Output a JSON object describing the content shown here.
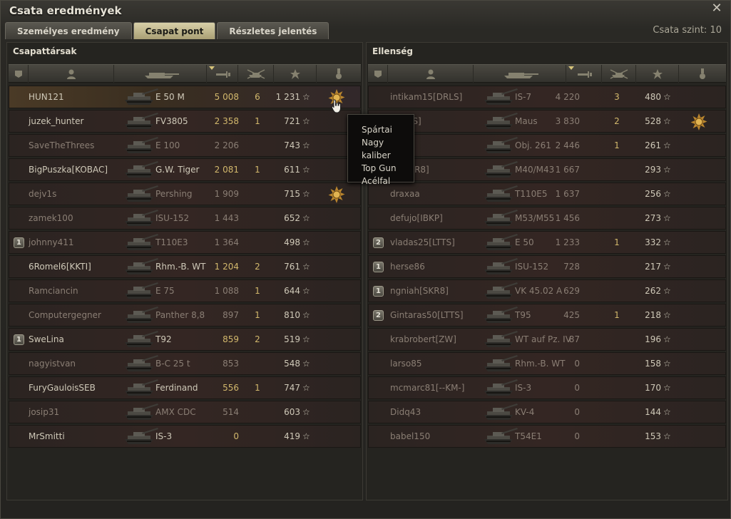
{
  "window": {
    "title": "Csata eredmények"
  },
  "tabs": [
    {
      "label": "Személyes eredmény",
      "active": false
    },
    {
      "label": "Csapat pont",
      "active": true
    },
    {
      "label": "Részletes jelentés",
      "active": false
    }
  ],
  "battle_level": "Csata szint: 10",
  "allies": {
    "title": "Csapattársak",
    "rows": [
      {
        "squad": "",
        "name": "HUN121",
        "tank": "E 50 M",
        "damage": "5 008",
        "kills": "6",
        "xp": "1 231",
        "medal": true,
        "alive": true,
        "self": true,
        "hi": true
      },
      {
        "squad": "",
        "name": "juzek_hunter",
        "tank": "FV3805",
        "damage": "2 358",
        "kills": "1",
        "xp": "721",
        "medal": false,
        "alive": true,
        "self": false,
        "hi": true
      },
      {
        "squad": "",
        "name": "SaveTheThrees",
        "tank": "E 100",
        "damage": "2 206",
        "kills": "",
        "xp": "743",
        "medal": false,
        "alive": false,
        "self": false,
        "hi": false
      },
      {
        "squad": "",
        "name": "BigPuszka[KOBAC]",
        "tank": "G.W. Tiger",
        "damage": "2 081",
        "kills": "1",
        "xp": "611",
        "medal": false,
        "alive": true,
        "self": false,
        "hi": true
      },
      {
        "squad": "",
        "name": "dejv1s",
        "tank": "Pershing",
        "damage": "1 909",
        "kills": "",
        "xp": "715",
        "medal": true,
        "alive": false,
        "self": false,
        "hi": false
      },
      {
        "squad": "",
        "name": "zamek100",
        "tank": "ISU-152",
        "damage": "1 443",
        "kills": "",
        "xp": "652",
        "medal": false,
        "alive": false,
        "self": false,
        "hi": false
      },
      {
        "squad": "1",
        "name": "johnny411",
        "tank": "T110E3",
        "damage": "1 364",
        "kills": "",
        "xp": "498",
        "medal": false,
        "alive": false,
        "self": false,
        "hi": false
      },
      {
        "squad": "",
        "name": "6Romel6[KKTI]",
        "tank": "Rhm.-B. WT",
        "damage": "1 204",
        "kills": "2",
        "xp": "761",
        "medal": false,
        "alive": true,
        "self": false,
        "hi": true
      },
      {
        "squad": "",
        "name": "Ramciancin",
        "tank": "E 75",
        "damage": "1 088",
        "kills": "1",
        "xp": "644",
        "medal": false,
        "alive": false,
        "self": false,
        "hi": false
      },
      {
        "squad": "",
        "name": "Computergegner",
        "tank": "Panther 8,8",
        "damage": "897",
        "kills": "1",
        "xp": "810",
        "medal": false,
        "alive": false,
        "self": false,
        "hi": false
      },
      {
        "squad": "1",
        "name": "SweLina",
        "tank": "T92",
        "damage": "859",
        "kills": "2",
        "xp": "519",
        "medal": false,
        "alive": true,
        "self": false,
        "hi": true
      },
      {
        "squad": "",
        "name": "nagyistvan",
        "tank": "B-C 25 t",
        "damage": "853",
        "kills": "",
        "xp": "548",
        "medal": false,
        "alive": false,
        "self": false,
        "hi": false
      },
      {
        "squad": "",
        "name": "FuryGauloisSEB",
        "tank": "Ferdinand",
        "damage": "556",
        "kills": "1",
        "xp": "747",
        "medal": false,
        "alive": true,
        "self": false,
        "hi": true
      },
      {
        "squad": "",
        "name": "josip31",
        "tank": "AMX CDC",
        "damage": "514",
        "kills": "",
        "xp": "603",
        "medal": false,
        "alive": false,
        "self": false,
        "hi": false
      },
      {
        "squad": "",
        "name": "MrSmitti",
        "tank": "IS-3",
        "damage": "0",
        "kills": "",
        "xp": "419",
        "medal": false,
        "alive": true,
        "self": false,
        "hi": true
      }
    ]
  },
  "enemies": {
    "title": "Ellenség",
    "rows": [
      {
        "squad": "",
        "name": "intikam15[DRLS]",
        "tank": "IS-7",
        "damage": "4 220",
        "kills": "3",
        "xp": "480",
        "medal": false
      },
      {
        "squad": "",
        "name": "[GADS]",
        "tank": "Maus",
        "damage": "3 830",
        "kills": "2",
        "xp": "528",
        "medal": true
      },
      {
        "squad": "",
        "name": "e",
        "tank": "Obj. 261",
        "damage": "2 446",
        "kills": "1",
        "xp": "261",
        "medal": false
      },
      {
        "squad": "",
        "name": "ke[SKR8]",
        "tank": "M40/M43",
        "damage": "1 667",
        "kills": "",
        "xp": "293",
        "medal": false
      },
      {
        "squad": "",
        "name": "draxaa",
        "tank": "T110E5",
        "damage": "1 637",
        "kills": "",
        "xp": "256",
        "medal": false
      },
      {
        "squad": "",
        "name": "defujo[IBKP]",
        "tank": "M53/M55",
        "damage": "1 456",
        "kills": "",
        "xp": "273",
        "medal": false
      },
      {
        "squad": "2",
        "name": "vladas25[LTTS]",
        "tank": "E 50",
        "damage": "1 233",
        "kills": "1",
        "xp": "332",
        "medal": false
      },
      {
        "squad": "1",
        "name": "herse86",
        "tank": "ISU-152",
        "damage": "728",
        "kills": "",
        "xp": "217",
        "medal": false
      },
      {
        "squad": "1",
        "name": "ngniah[SKR8]",
        "tank": "VK 45.02 A",
        "damage": "629",
        "kills": "",
        "xp": "262",
        "medal": false
      },
      {
        "squad": "2",
        "name": "Gintaras50[LTTS]",
        "tank": "T95",
        "damage": "425",
        "kills": "1",
        "xp": "218",
        "medal": false
      },
      {
        "squad": "",
        "name": "krabrobert[ZW]",
        "tank": "WT auf Pz. IV",
        "damage": "87",
        "kills": "",
        "xp": "196",
        "medal": false
      },
      {
        "squad": "",
        "name": "larso85",
        "tank": "Rhm.-B. WT",
        "damage": "0",
        "kills": "",
        "xp": "158",
        "medal": false
      },
      {
        "squad": "",
        "name": "mcmarc81[--KM-]",
        "tank": "IS-3",
        "damage": "0",
        "kills": "",
        "xp": "170",
        "medal": false
      },
      {
        "squad": "",
        "name": "Didq43",
        "tank": "KV-4",
        "damage": "0",
        "kills": "",
        "xp": "144",
        "medal": false
      },
      {
        "squad": "",
        "name": "babel150",
        "tank": "T54E1",
        "damage": "0",
        "kills": "",
        "xp": "153",
        "medal": false
      }
    ]
  },
  "tooltip": {
    "lines": [
      "Spártai",
      "Nagy kaliber",
      "Top Gun",
      "Acélfal"
    ]
  },
  "colors": {
    "accent": "#d2b86c",
    "active_tab": "#c9c09a",
    "row_bg": "#342623"
  }
}
